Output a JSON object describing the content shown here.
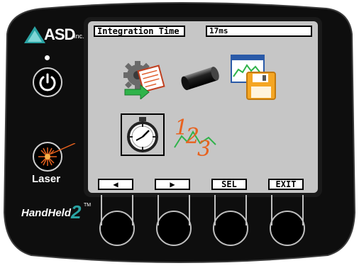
{
  "device": {
    "brand": "ASD",
    "brand_suffix": "Inc.",
    "model_name": "HandHeld",
    "model_number": "2",
    "model_trademark": "TM",
    "laser_label": "Laser"
  },
  "screen": {
    "field_label": "Integration Time",
    "field_value": "17ms",
    "icons": [
      "settings-gear-icon",
      "fiber-optic-icon",
      "save-spectrum-icon",
      "stopwatch-icon",
      "numeric-123-icon"
    ],
    "selected_icon": "stopwatch-icon"
  },
  "softkeys": {
    "left_label": "◀",
    "right_label": "▶",
    "select_label": "SEL",
    "exit_label": "EXIT"
  },
  "colors": {
    "body": "#111111",
    "screen_bg": "#c6c6c6",
    "logo_accent": "#2aa3a3",
    "laser_accent": "#e8621e"
  }
}
